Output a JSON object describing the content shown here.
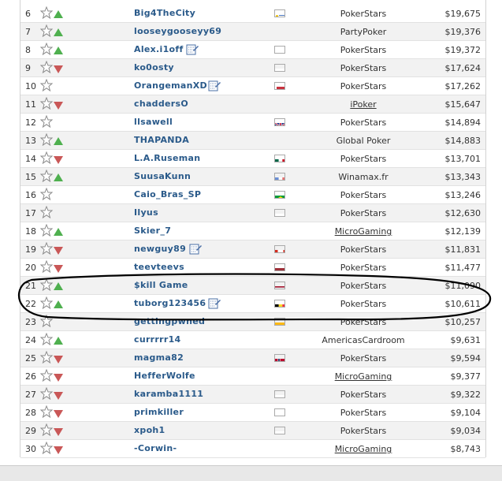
{
  "rows": [
    {
      "rank": "6",
      "trend": "up",
      "name": "Big4TheCity",
      "flag": "uruguay",
      "site": "PokerStars",
      "site_link": false,
      "amount": "$19,675",
      "note": false
    },
    {
      "rank": "7",
      "trend": "up",
      "name": "looseygooseyy69",
      "flag": "",
      "site": "PartyPoker",
      "site_link": false,
      "amount": "$19,376",
      "note": false
    },
    {
      "rank": "8",
      "trend": "up",
      "name": "Alex.i1off",
      "flag": "russia",
      "site": "PokerStars",
      "site_link": false,
      "amount": "$19,372",
      "note": true
    },
    {
      "rank": "9",
      "trend": "down",
      "name": "ko0osty",
      "flag": "russia",
      "site": "PokerStars",
      "site_link": false,
      "amount": "$17,624",
      "note": false
    },
    {
      "rank": "10",
      "trend": "none",
      "name": "OrangemanXD",
      "flag": "belarus",
      "site": "PokerStars",
      "site_link": false,
      "amount": "$17,262",
      "note": true
    },
    {
      "rank": "11",
      "trend": "down",
      "name": "chaddersO",
      "flag": "",
      "site": "iPoker",
      "site_link": true,
      "amount": "$15,647",
      "note": false
    },
    {
      "rank": "12",
      "trend": "none",
      "name": "llsawell",
      "flag": "uk",
      "site": "PokerStars",
      "site_link": false,
      "amount": "$14,894",
      "note": false
    },
    {
      "rank": "13",
      "trend": "up",
      "name": "THAPANDA",
      "flag": "",
      "site": "Global Poker",
      "site_link": false,
      "amount": "$14,883",
      "note": false
    },
    {
      "rank": "14",
      "trend": "down",
      "name": "L.A.Ruseman",
      "flag": "mexico",
      "site": "PokerStars",
      "site_link": false,
      "amount": "$13,701",
      "note": false
    },
    {
      "rank": "15",
      "trend": "up",
      "name": "SuusaKunn",
      "flag": "france",
      "site": "Winamax.fr",
      "site_link": false,
      "amount": "$13,343",
      "note": false
    },
    {
      "rank": "16",
      "trend": "none",
      "name": "Caio_Bras_SP",
      "flag": "brazil",
      "site": "PokerStars",
      "site_link": false,
      "amount": "$13,246",
      "note": false
    },
    {
      "rank": "17",
      "trend": "none",
      "name": "Ilyus",
      "flag": "russia",
      "site": "PokerStars",
      "site_link": false,
      "amount": "$12,630",
      "note": false
    },
    {
      "rank": "18",
      "trend": "up",
      "name": "Skier_7",
      "flag": "",
      "site": "MicroGaming",
      "site_link": true,
      "amount": "$12,139",
      "note": false
    },
    {
      "rank": "19",
      "trend": "down",
      "name": "newguy89",
      "flag": "canada",
      "site": "PokerStars",
      "site_link": false,
      "amount": "$11,831",
      "note": true
    },
    {
      "rank": "20",
      "trend": "down",
      "name": "teevteevs",
      "flag": "latvia",
      "site": "PokerStars",
      "site_link": false,
      "amount": "$11,477",
      "note": false
    },
    {
      "rank": "21",
      "trend": "up",
      "name": "$kill Game",
      "flag": "thailand",
      "site": "PokerStars",
      "site_link": false,
      "amount": "$11,090",
      "note": false
    },
    {
      "rank": "22",
      "trend": "up",
      "name": "tuborg123456",
      "flag": "belgium",
      "site": "PokerStars",
      "site_link": false,
      "amount": "$10,611",
      "note": true
    },
    {
      "rank": "23",
      "trend": "none",
      "name": "gettingpwned",
      "flag": "lithuania",
      "site": "PokerStars",
      "site_link": false,
      "amount": "$10,257",
      "note": false
    },
    {
      "rank": "24",
      "trend": "up",
      "name": "currrrr14",
      "flag": "",
      "site": "AmericasCardroom",
      "site_link": false,
      "amount": "$9,631",
      "note": false
    },
    {
      "rank": "25",
      "trend": "down",
      "name": "magma82",
      "flag": "norway",
      "site": "PokerStars",
      "site_link": false,
      "amount": "$9,594",
      "note": false
    },
    {
      "rank": "26",
      "trend": "down",
      "name": "HefferWolfe",
      "flag": "",
      "site": "MicroGaming",
      "site_link": true,
      "amount": "$9,377",
      "note": false
    },
    {
      "rank": "27",
      "trend": "down",
      "name": "karamba1111",
      "flag": "russia",
      "site": "PokerStars",
      "site_link": false,
      "amount": "$9,322",
      "note": false
    },
    {
      "rank": "28",
      "trend": "down",
      "name": "primkiller",
      "flag": "russia",
      "site": "PokerStars",
      "site_link": false,
      "amount": "$9,104",
      "note": false
    },
    {
      "rank": "29",
      "trend": "down",
      "name": "xpoh1",
      "flag": "russia",
      "site": "PokerStars",
      "site_link": false,
      "amount": "$9,034",
      "note": false
    },
    {
      "rank": "30",
      "trend": "down",
      "name": "-Corwin-",
      "flag": "",
      "site": "MicroGaming",
      "site_link": true,
      "amount": "$8,743",
      "note": false
    }
  ],
  "colors": {
    "name_link": "#2a5a8a",
    "trend_up": "#4fb04f",
    "trend_down": "#c95757",
    "row_alt": "#f2f2f2"
  }
}
